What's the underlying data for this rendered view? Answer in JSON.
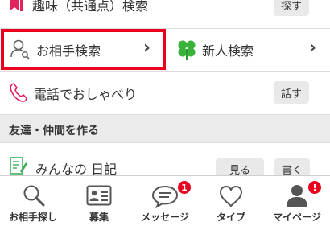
{
  "rows": {
    "hobby": {
      "label": "趣味（共通点）検索",
      "button": "探す"
    },
    "partner_search": {
      "label": "お相手検索",
      "chevron": "›"
    },
    "new_search": {
      "label": "新人検索",
      "chevron": "›"
    },
    "phone": {
      "label": "電話でおしゃべり",
      "button": "話す"
    },
    "diary": {
      "label": "みんなの 日記",
      "view_button": "見る",
      "write_button": "書く"
    }
  },
  "section": {
    "title": "友達・仲間を作る"
  },
  "tabs": [
    {
      "label": "お相手探し",
      "icon": "search-icon"
    },
    {
      "label": "募集",
      "icon": "id-card-icon"
    },
    {
      "label": "メッセージ",
      "icon": "chat-bubble-icon",
      "badge": "1"
    },
    {
      "label": "タイプ",
      "icon": "heart-icon"
    },
    {
      "label": "マイページ",
      "icon": "person-icon",
      "badge": "!"
    }
  ],
  "colors": {
    "accent_red": "#e8001c",
    "clover_green": "#3bb33b",
    "bookmark_pink": "#e0245e",
    "diary_green": "#3fae5a"
  }
}
